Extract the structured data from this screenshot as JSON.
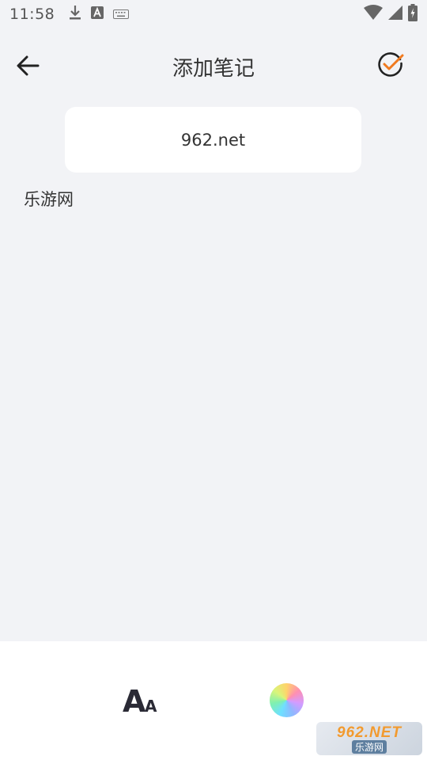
{
  "status_bar": {
    "time": "11:58",
    "icons": [
      "download-icon",
      "font-a-icon",
      "keyboard-icon",
      "wifi-icon",
      "signal-icon",
      "battery-icon"
    ]
  },
  "app_bar": {
    "title": "添加笔记",
    "back_icon": "arrow-left-icon",
    "confirm_icon": "check-circle-icon",
    "accent_color": "#f07a1f"
  },
  "note": {
    "title_value": "962.net",
    "body_value": "乐游网"
  },
  "toolbar": {
    "font_label_big": "A",
    "font_label_small": "A",
    "color_icon": "color-wheel-icon"
  },
  "watermark": {
    "top": "962.NET",
    "bottom": "乐游网"
  }
}
